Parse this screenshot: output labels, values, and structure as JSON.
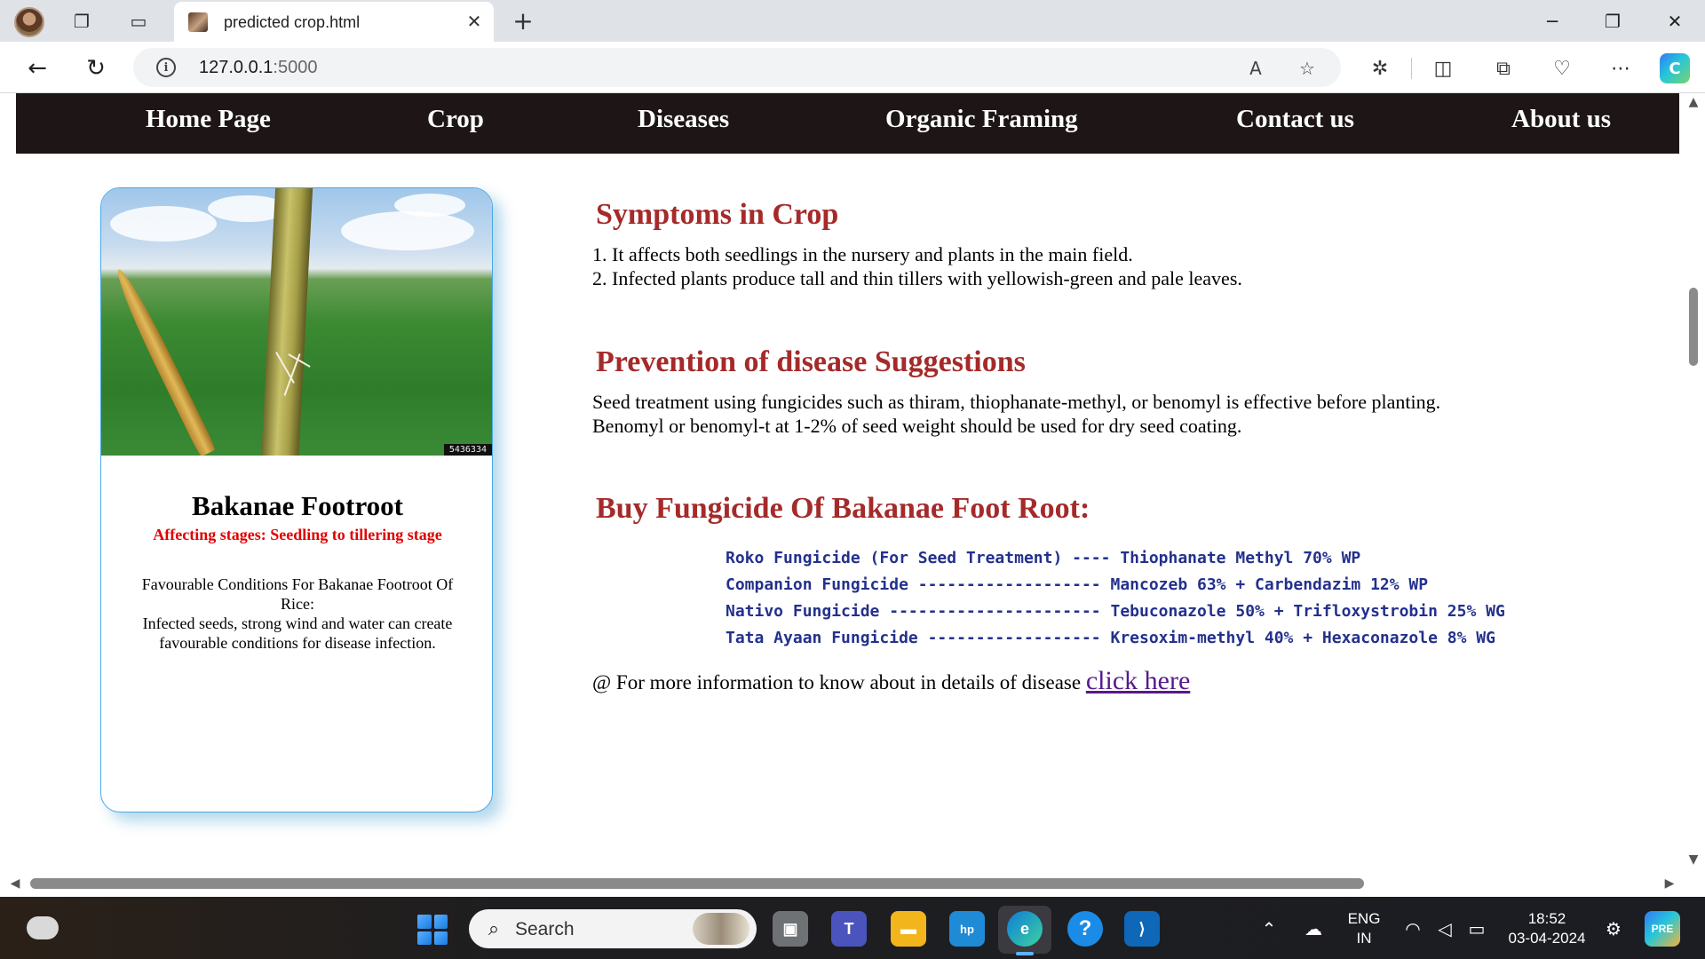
{
  "browser": {
    "tab_title": "predicted crop.html",
    "url_host": "127.0.0.1",
    "url_port": ":5000"
  },
  "nav": [
    "Home Page",
    "Crop",
    "Diseases",
    "Organic Framing",
    "Contact us",
    "About us"
  ],
  "card": {
    "image_tag": "5436334",
    "title": "Bakanae Footroot",
    "subtitle": "Affecting stages: Seedling to tillering stage",
    "conditions_heading": "Favourable Conditions For Bakanae Footroot Of Rice:",
    "conditions_text": "Infected seeds, strong wind and water can create favourable conditions for disease infection."
  },
  "symptoms": {
    "heading": "Symptoms in Crop",
    "lines": [
      "1. It affects both seedlings in the nursery and plants in the main field.",
      "2. Infected plants produce tall and thin tillers with yellowish-green and pale leaves."
    ]
  },
  "prevention": {
    "heading": "Prevention of disease Suggestions",
    "lines": [
      "Seed treatment using fungicides such as thiram, thiophanate-methyl, or benomyl is effective before planting.",
      "Benomyl or benomyl-t at 1-2% of seed weight should be used for dry seed coating."
    ]
  },
  "buy": {
    "heading": "Buy Fungicide Of Bakanae Foot Root:",
    "items": [
      "Roko Fungicide (For Seed Treatment) ---- Thiophanate Methyl 70% WP",
      "Companion Fungicide ------------------- Mancozeb 63% + Carbendazim 12% WP",
      "Nativo Fungicide ---------------------- Tebuconazole 50% + Trifloxystrobin 25% WG",
      "Tata Ayaan Fungicide ------------------ Kresoxim-methyl 40% + Hexaconazole 8% WG"
    ]
  },
  "more_info": {
    "text": "@ For more information to know about in details of disease ",
    "link": "click here"
  },
  "taskbar": {
    "search_placeholder": "Search",
    "lang_top": "ENG",
    "lang_bottom": "IN",
    "time": "18:52",
    "date": "03-04-2024"
  },
  "colors": {
    "navbar_bg": "#1e1616",
    "heading": "#a52a2a",
    "subtitle": "#e00000",
    "fungicide_text": "#23318c",
    "link": "#551a8b",
    "card_border": "#4aa9e4"
  }
}
